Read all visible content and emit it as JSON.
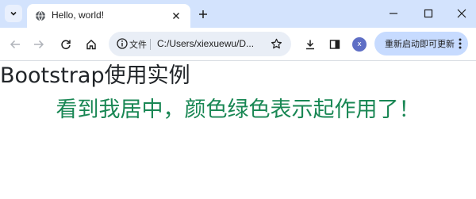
{
  "tab": {
    "title": "Hello, world!"
  },
  "omnibox": {
    "chip_label": "文件",
    "url": "C:/Users/xiexuewu/D..."
  },
  "toolbar": {
    "update_label": "重新启动即可更新",
    "profile_initial": "x"
  },
  "content": {
    "heading": "Bootstrap使用实例",
    "green_text": "看到我居中，颜色绿色表示起作用了！"
  },
  "colors": {
    "tabstrip": "#d3e3fd",
    "update_button": "#c7dbff",
    "success_text": "#198754",
    "profile": "#5e6ec5"
  }
}
